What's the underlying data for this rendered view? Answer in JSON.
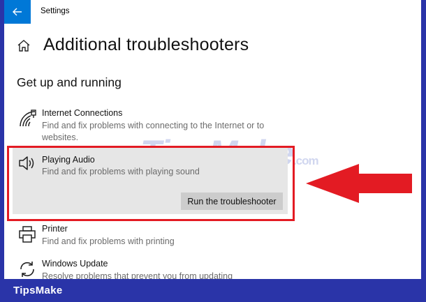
{
  "window": {
    "app_title": "Settings"
  },
  "header": {
    "page_title": "Additional troubleshooters"
  },
  "section": {
    "title": "Get up and running"
  },
  "items": [
    {
      "name": "Internet Connections",
      "description": "Find and fix problems with connecting to the Internet or to websites.",
      "icon": "wifi-icon"
    },
    {
      "name": "Playing Audio",
      "description": "Find and fix problems with playing sound",
      "icon": "speaker-icon",
      "button": "Run the troubleshooter"
    },
    {
      "name": "Printer",
      "description": "Find and fix problems with printing",
      "icon": "printer-icon"
    },
    {
      "name": "Windows Update",
      "description": "Resolve problems that prevent you from updating Windows.",
      "icon": "sync-icon"
    }
  ],
  "watermark": {
    "main": "TipsMake",
    "suffix": ".com"
  },
  "footer": {
    "brand": "TipsMake"
  },
  "colors": {
    "accent": "#0078d7",
    "highlight": "#e31b23",
    "banner": "#2a34a8",
    "selected_bg": "#e6e6e6"
  }
}
